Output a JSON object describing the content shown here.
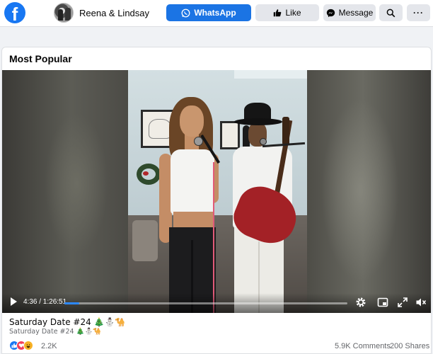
{
  "header": {
    "page_name": "Reena & Lindsay",
    "whatsapp_label": "WhatsApp",
    "like_label": "Like",
    "message_label": "Message",
    "more_label": "···",
    "logo_letter": "f"
  },
  "section": {
    "title": "Most Popular"
  },
  "video": {
    "time": "4:36 / 1:26:51",
    "progress_fraction": 0.053,
    "colors": {
      "progress": "#2d88ff"
    }
  },
  "post": {
    "caption": "Saturday Date #24 🎄⛄🐪",
    "subcaption": "Saturday Date #24 🎄⛄🐪",
    "reaction_count": "2.2K",
    "comments": "5.9K Comments",
    "shares": "200 Shares"
  },
  "icons": [
    "facebook-logo-icon",
    "whatsapp-icon",
    "thumbs-up-icon",
    "messenger-icon",
    "search-icon",
    "play-icon",
    "settings-icon",
    "miniplayer-icon",
    "fullscreen-icon",
    "mute-icon",
    "like-reaction-icon",
    "love-reaction-icon",
    "haha-reaction-icon"
  ],
  "colors": {
    "brand": "#1877f2",
    "whatsapp_button": "#1b74e4",
    "secondary_button": "#e4e6eb"
  }
}
